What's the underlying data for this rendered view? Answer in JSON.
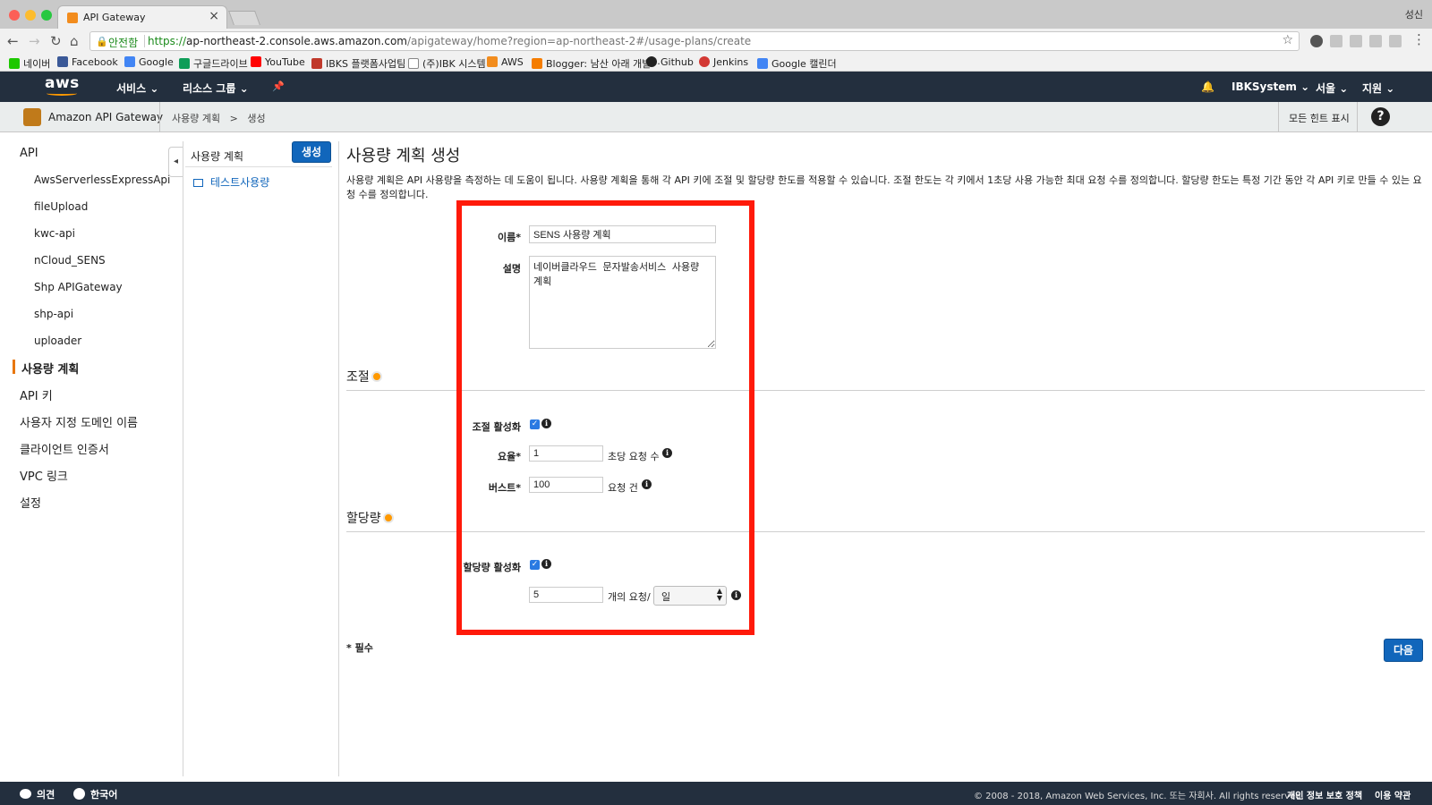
{
  "browser": {
    "tab_title": "API Gateway",
    "tab_close": "×",
    "profile": "성신",
    "secure_label": "안전함",
    "url_scheme": "https://",
    "url_host": "ap-northeast-2.console.aws.amazon.com",
    "url_path": "/apigateway/home?region=ap-northeast-2#/usage-plans/create",
    "back": "←",
    "forward": "→",
    "reload": "↻",
    "home": "⌂",
    "star": "☆",
    "bookmarks": [
      {
        "label": "네이버",
        "color": "#1ec800"
      },
      {
        "label": "Facebook",
        "color": "#3b5998"
      },
      {
        "label": "Google",
        "color": "#4285f4"
      },
      {
        "label": "구글드라이브",
        "color": "#0f9d58"
      },
      {
        "label": "YouTube",
        "color": "#ff0000"
      },
      {
        "label": "IBKS 플랫폼사업팀",
        "color": "#c0392b"
      },
      {
        "label": "(주)IBK 시스템",
        "color": "#888888"
      },
      {
        "label": "AWS",
        "color": "#f28c1d"
      },
      {
        "label": "Blogger: 남산 아래 개발···",
        "color": "#f57d00"
      },
      {
        "label": "Github",
        "color": "#222222"
      },
      {
        "label": "Jenkins",
        "color": "#d33833"
      },
      {
        "label": "Google 캘린더",
        "color": "#4285f4"
      }
    ]
  },
  "aws_nav": {
    "logo": "aws",
    "services": "서비스",
    "resource_groups": "리소스 그룹",
    "pin": "📌",
    "bell": "🔔",
    "account": "IBKSystem",
    "region": "서울",
    "support": "지원",
    "caret": "⌄"
  },
  "subheader": {
    "service": "Amazon API Gateway",
    "crumb_parent": "사용량 계획",
    "crumb_sep": ">",
    "crumb_current": "생성",
    "hints": "모든 힌트 표시",
    "help": "?"
  },
  "sidebar": {
    "api_header": "API",
    "apis": [
      "AwsServerlessExpressApi",
      "fileUpload",
      "kwc-api",
      "nCloud_SENS",
      "Shp APIGateway",
      "shp-api",
      "uploader"
    ],
    "items": [
      "사용량 계획",
      "API 키",
      "사용자 지정 도메인 이름",
      "클라이언트 인증서",
      "VPC 링크",
      "설정"
    ],
    "collapse": "◂"
  },
  "plans_panel": {
    "title": "사용량 계획",
    "create": "생성",
    "items": [
      "테스트사용량"
    ]
  },
  "form": {
    "title": "사용량 계획 생성",
    "description": "사용량 계획은 API 사용량을 측정하는 데 도움이 됩니다. 사용량 계획을 통해 각 API 키에 조절 및 할당량 한도를 적용할 수 있습니다. 조절 한도는 각 키에서 1초당 사용 가능한 최대 요청 수를 정의합니다. 할당량 한도는 특정 기간 동안 각 API 키로 만들 수 있는 요청 수를 정의합니다.",
    "name_label": "이름*",
    "name_value": "SENS 사용량 계획",
    "desc_label": "설명",
    "desc_value": "네이버클라우드 문자발송서비스 사용량 계획",
    "throttle_section": "조절",
    "throttle_enable": "조절 활성화",
    "rate_label": "요율*",
    "rate_value": "1",
    "rate_unit": "초당 요청 수",
    "burst_label": "버스트*",
    "burst_value": "100",
    "burst_unit": "요청 건",
    "quota_section": "할당량",
    "quota_enable": "할당량 활성화",
    "quota_value": "5",
    "quota_unit": "개의 요청/",
    "quota_period": "일",
    "checkmark": "✓",
    "info": "i",
    "required": "* 필수",
    "next": "다음"
  },
  "footer": {
    "feedback": "의견",
    "language": "한국어",
    "copyright": "© 2008 - 2018, Amazon Web Services, Inc. 또는 자회사. All rights reserved.",
    "privacy": "개인 정보 보호 정책",
    "terms": "이용 약관"
  }
}
